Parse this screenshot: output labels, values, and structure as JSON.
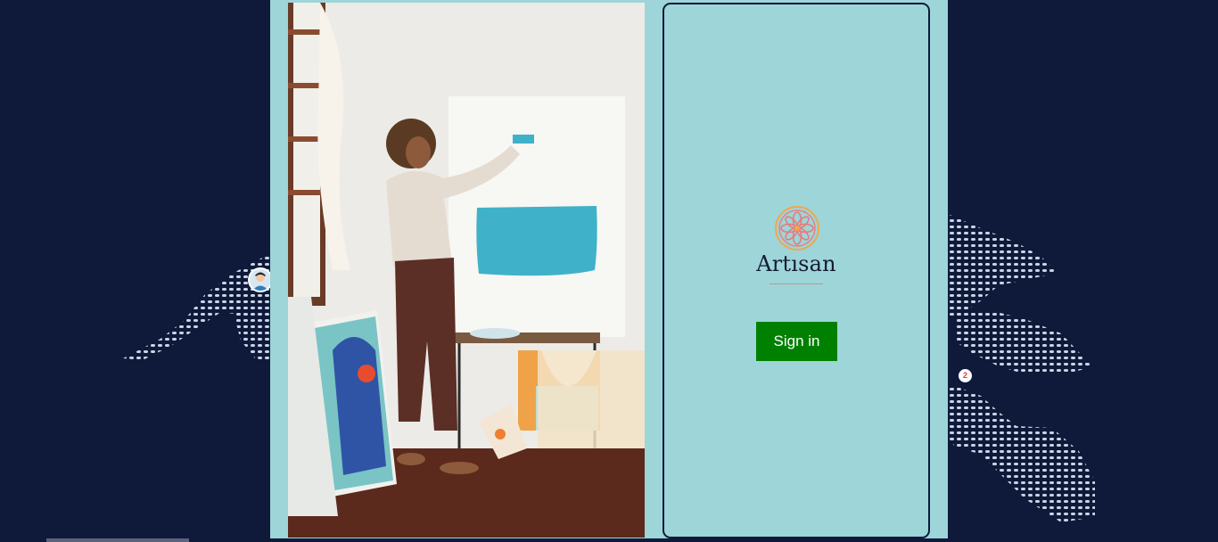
{
  "brand": {
    "name": "Artısan",
    "accent_color": "#e78a7b"
  },
  "signin": {
    "button_label": "Sign in",
    "button_color": "#008000"
  },
  "map": {
    "count_badge": "2"
  },
  "colors": {
    "background": "#0f1a3a",
    "panel": "#9dd5d9",
    "map_dots": "#c9d4e6"
  }
}
